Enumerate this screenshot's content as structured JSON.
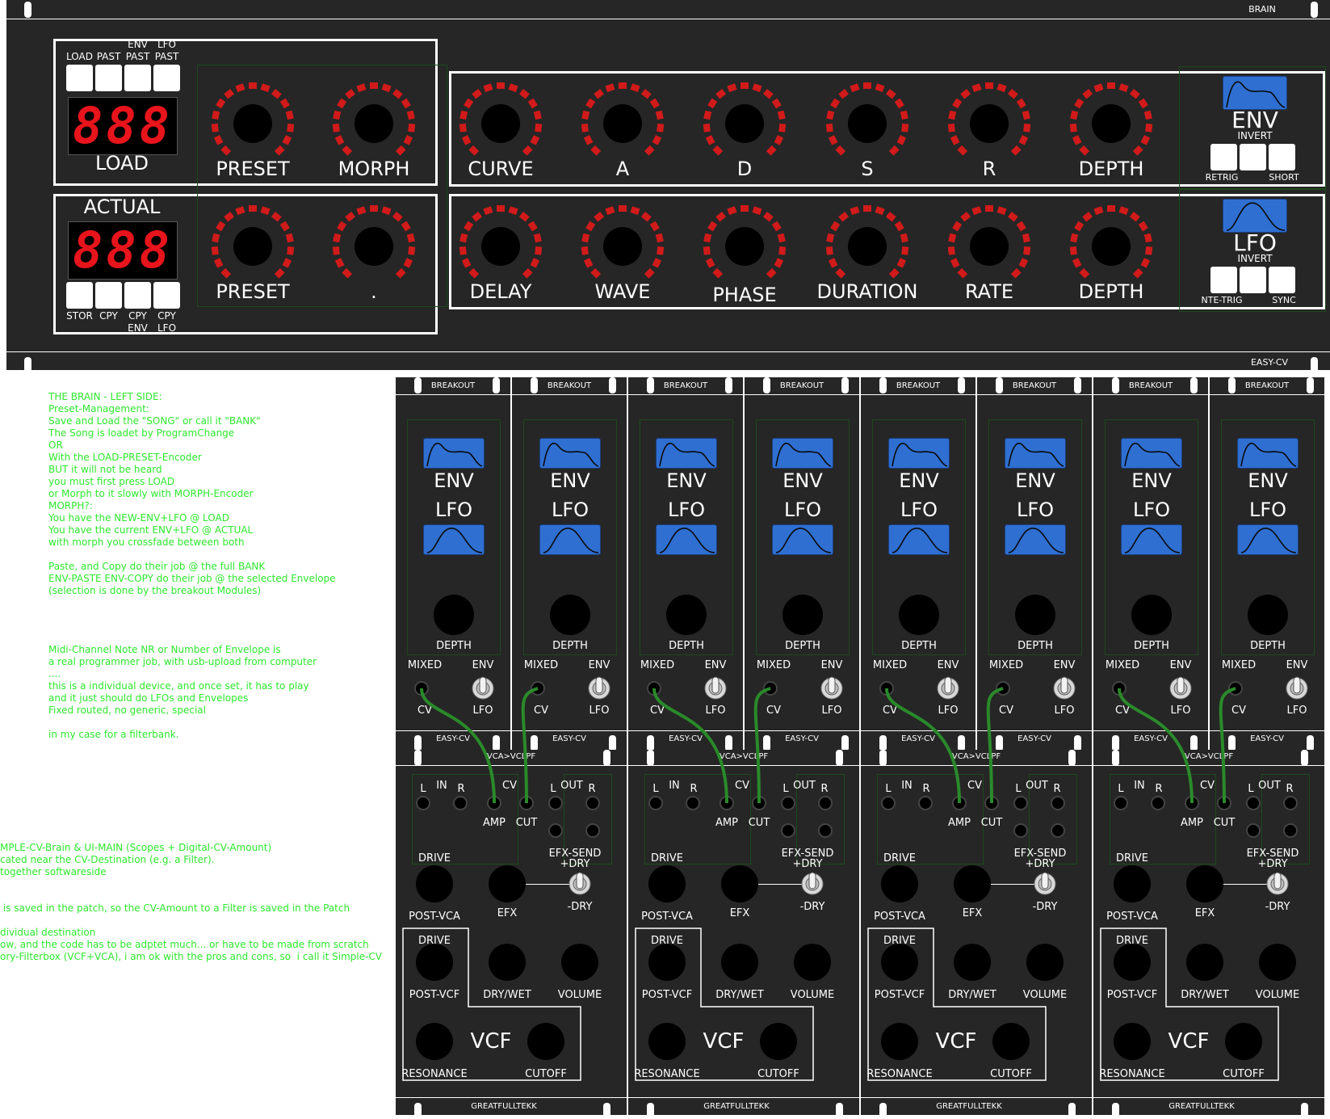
{
  "brain": {
    "header_label": "BRAIN",
    "footer_label": "EASY-CV",
    "load_block": {
      "button_labels": [
        "LOAD",
        "PAST",
        "ENV\nPAST",
        "LFO\nPAST"
      ],
      "display": "888",
      "title": "LOAD"
    },
    "actual_block": {
      "title": "ACTUAL",
      "display": "888",
      "button_labels": [
        "STOR",
        "CPY",
        "CPY\nENV",
        "CPY\nLFO"
      ]
    },
    "preset_knobs_top": [
      "PRESET",
      "MORPH"
    ],
    "preset_knobs_bottom": [
      "PRESET",
      "."
    ],
    "env_knobs": [
      "CURVE",
      "A",
      "D",
      "S",
      "R",
      "DEPTH"
    ],
    "lfo_knobs": [
      "DELAY",
      "WAVE",
      "PHASE",
      "DURATION",
      "RATE",
      "DEPTH"
    ],
    "env_side": {
      "title": "ENV",
      "sub": "INVERT",
      "left": "RETRIG",
      "right": "SHORT"
    },
    "lfo_side": {
      "title": "LFO",
      "sub": "INVERT",
      "left": "NTE-TRIG",
      "right": "SYNC"
    }
  },
  "breakout": {
    "header_label": "BREAKOUT",
    "footer_label": "EASY-CV",
    "env_label": "ENV",
    "lfo_label": "LFO",
    "depth_label": "DEPTH",
    "mixed_label": "MIXED",
    "env_switch_label": "ENV",
    "cv_label": "CV",
    "lfo_switch_label": "LFO",
    "count": 8
  },
  "vca": {
    "header_label": "VCA>VCLPF",
    "footer_label": "GREATFULLTEKK",
    "in_label": "IN",
    "out_label": "OUT",
    "l_label": "L",
    "r_label": "R",
    "cv_label": "CV",
    "amp_label": "AMP",
    "cut_label": "CUT",
    "efx_send_label": "EFX-SEND\n+DRY",
    "drive_label": "DRIVE",
    "post_vca_label": "POST-VCA",
    "efx_label": "EFX",
    "dry_label": "-DRY",
    "post_vcf_label": "POST-VCF",
    "drywet_label": "DRY/WET",
    "volume_label": "VOLUME",
    "vcf_label": "VCF",
    "resonance_label": "RESONANCE",
    "cutoff_label": "CUTOFF",
    "count": 4
  },
  "notes": {
    "brain_left": "THE BRAIN - LEFT SIDE:\nPreset-Management:\nSave and Load the \"SONG\" or call it \"BANK\"\nThe Song is loadet by ProgramChange\nOR\nWith the LOAD-PRESET-Encoder\nBUT it will not be heard\nyou must first press LOAD\nor Morph to it slowly with MORPH-Encoder\nMORPH?:\nYou have the NEW-ENV+LFO @ LOAD\nYou have the current ENV+LFO @ ACTUAL\nwith morph you crossfade between both\n\nPaste, and Copy do their job @ the full BANK\nENV-PASTE ENV-COPY do their job @ the selected Envelope\n(selection is done by the breakout Modules)",
    "midi": "Midi-Channel Note NR or Number of Envelope is\na real programmer job, with usb-upload from computer\n....\nthis is a individual device, and once set, it has to play\nand it just should do LFOs and Envelopes\nFixed routed, no generic, special\n\nin my case for a filterbank.",
    "simple_cv": "MPLE-CV-Brain & UI-MAIN (Scopes + Digital-CV-Amount)\ncated near the CV-Destination (e.g. a Filter).\ntogether softwareside\n\n\n is saved in the patch, so the CV-Amount to a Filter is saved in the Patch\n\ndividual destination\now, and the code has to be adptet much... or have to be made from scratch\nory-Filterbox (VCF+VCA), i am ok with the pros and cons, so  i call it Simple-CV"
  },
  "colors": {
    "panel": "#262626",
    "ring": "#d11a1a",
    "scope": "#2f6fd1",
    "note": "#2ee82e",
    "cable": "#2a8a2a"
  }
}
